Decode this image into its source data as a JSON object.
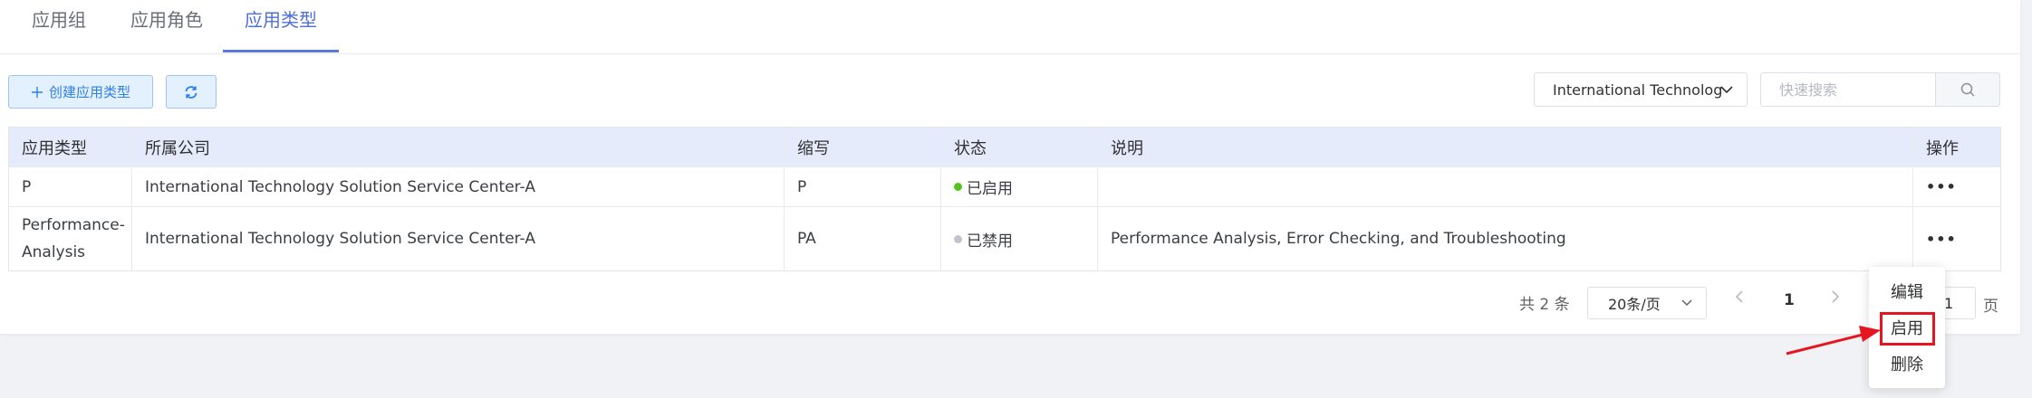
{
  "tabs": [
    {
      "label": "应用组"
    },
    {
      "label": "应用角色"
    },
    {
      "label": "应用类型"
    }
  ],
  "toolbar": {
    "create_label": "创建应用类型",
    "company_selected": "International Technology Solution Service Center-A",
    "search_placeholder": "快速搜索"
  },
  "table": {
    "headers": [
      "应用类型",
      "所属公司",
      "缩写",
      "状态",
      "说明",
      "操作"
    ],
    "rows": [
      {
        "type": "P",
        "company": "International Technology Solution Service Center-A",
        "abbr": "P",
        "status": "已启用",
        "status_color": "#52c41a",
        "desc": "",
        "action": "•••"
      },
      {
        "type": "Performance-Analysis",
        "company": "International Technology Solution Service Center-A",
        "abbr": "PA",
        "status": "已禁用",
        "status_color": "#c0c4cc",
        "desc": "Performance Analysis, Error Checking, and Troubleshooting",
        "action": "•••"
      }
    ]
  },
  "pagination": {
    "total": "共 2 条",
    "page_size": "20条/页",
    "current": "1",
    "goto": "1",
    "unit": "页"
  },
  "menu": {
    "items": [
      "编辑",
      "启用",
      "删除"
    ]
  },
  "colors": {
    "accent": "#5a78e0",
    "highlight": "#e5161f"
  }
}
